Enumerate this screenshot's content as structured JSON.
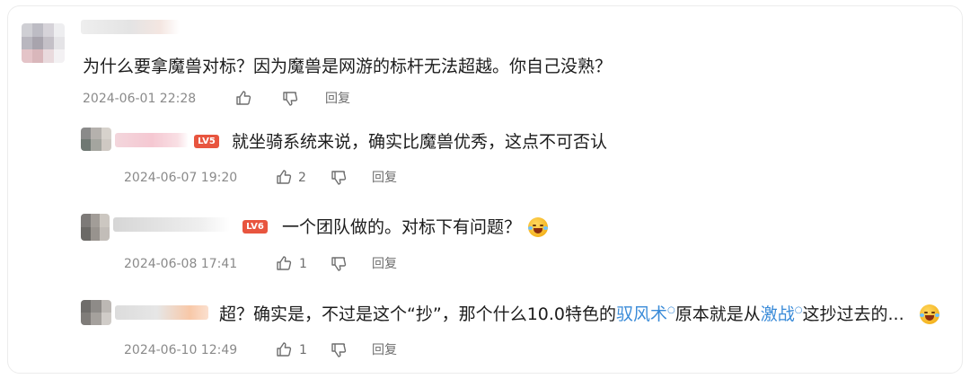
{
  "comments": [
    {
      "content": "为什么要拿魔兽对标？因为魔兽是网游的标杆无法超越。你自己没熟？",
      "time": "2024-06-01 22:28",
      "reply_label": "回复"
    }
  ],
  "replies": [
    {
      "badge": "LV5",
      "content": "就坐骑系统来说，确实比魔兽优秀，这点不可否认",
      "time": "2024-06-07 19:20",
      "likes": "2",
      "reply_label": "回复"
    },
    {
      "badge": "LV6",
      "content": "一个团队做的。对标下有问题？",
      "time": "2024-06-08 17:41",
      "likes": "1",
      "reply_label": "回复"
    },
    {
      "content_prefix": "超？确实是，不过是这个“抄”，那个什么10.0特色的",
      "link_1": "驭风术",
      "content_mid": "原本就是从",
      "link_2": "激战",
      "content_suffix": "这抄过去的...",
      "time": "2024-06-10 12:49",
      "likes": "1",
      "reply_label": "回复"
    }
  ],
  "icons": {
    "like": "thumbs-up-icon",
    "dislike": "thumbs-down-icon",
    "search_hint": "search-hint-icon",
    "emoji": "laughing-tears-emoji"
  },
  "colors": {
    "link": "#3a8bd8",
    "badge": "#e8553f",
    "meta": "#8a8a8a"
  }
}
